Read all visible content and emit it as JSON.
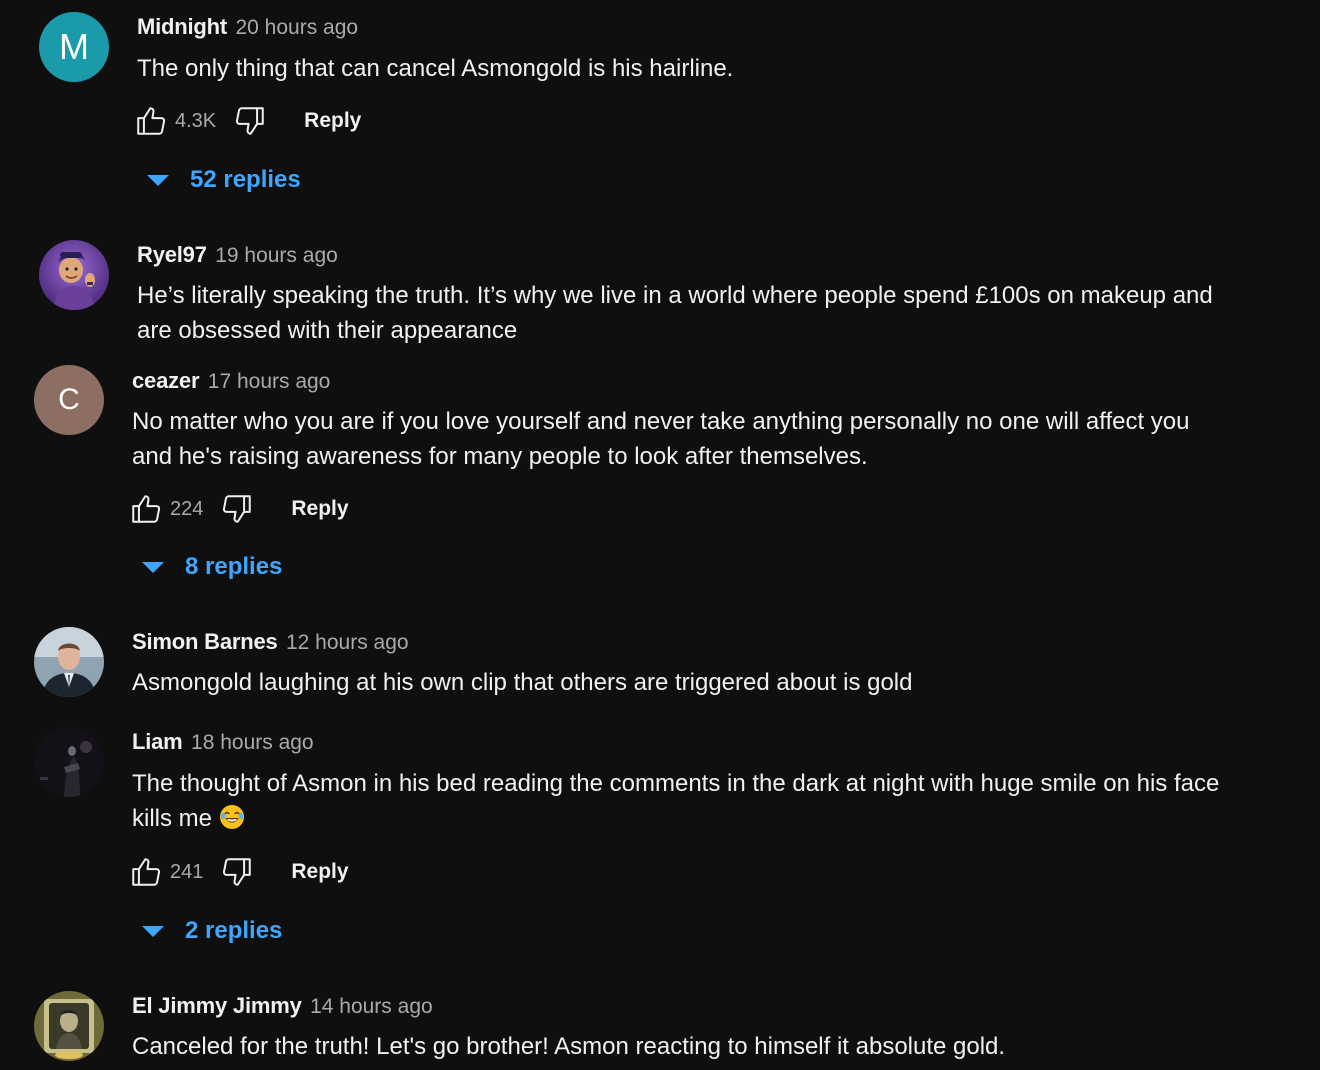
{
  "comments": [
    {
      "author": "Midnight",
      "time": "20 hours ago",
      "avatar_letter": "M",
      "text": "The only thing that can cancel Asmongold is his hairline.",
      "likes": "4.3K",
      "reply_label": "Reply",
      "replies_label": "52 replies"
    },
    {
      "author": "Ryel97",
      "time": "19 hours ago",
      "text": "He’s literally speaking the truth. It’s why we live in a world where people spend £100s on makeup and are obsessed with their appearance"
    },
    {
      "author": "ceazer",
      "time": "17 hours ago",
      "avatar_letter": "C",
      "text": "No matter who you are if you love yourself and never take anything personally no one will affect you and he's raising awareness for many people to look after themselves.",
      "likes": "224",
      "reply_label": "Reply",
      "replies_label": "8 replies"
    },
    {
      "author": "Simon Barnes",
      "time": "12 hours ago",
      "text": "Asmongold laughing at his own clip that others are triggered about is gold"
    },
    {
      "author": "Liam",
      "time": "18 hours ago",
      "text": "The thought of Asmon in his bed reading the comments in the dark at night with huge smile on his face kills me",
      "likes": "241",
      "reply_label": "Reply",
      "replies_label": "2 replies"
    },
    {
      "author": "El Jimmy Jimmy",
      "time": "14 hours ago",
      "text": "Canceled for the truth!  Let's go brother!  Asmon reacting to himself it absolute gold."
    }
  ],
  "icons": {
    "like": "thumbs-up-outline-icon",
    "dislike": "thumbs-down-outline-icon",
    "expand": "triangle-down-icon",
    "emoji": "tears-of-joy-emoji"
  },
  "colors": {
    "background": "#0f0f0f",
    "text": "#f1f1f1",
    "secondary_text": "#aaaaaa",
    "link_blue": "#3ea6ff",
    "avatar_m": "#1b9aaa",
    "avatar_c": "#8d6e63"
  }
}
